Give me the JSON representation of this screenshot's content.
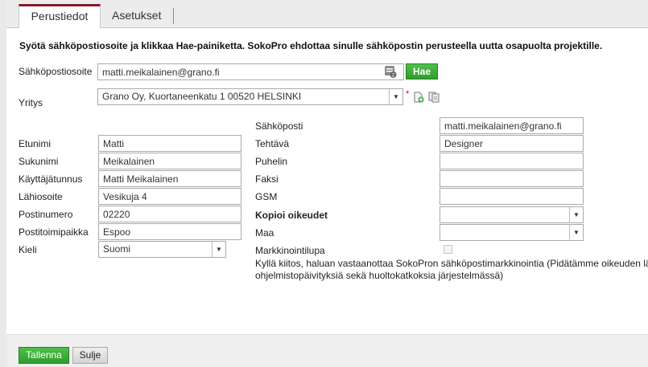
{
  "tabs": [
    {
      "label": "Perustiedot",
      "active": true
    },
    {
      "label": "Asetukset",
      "active": false
    }
  ],
  "intro": "Syötä sähköpostiosoite ja klikkaa Hae-painiketta. SokoPro ehdottaa sinulle sähköpostin perusteella uutta osapuolta projektille.",
  "lookup": {
    "label": "Sähköpostiosoite",
    "value": "matti.meikalainen@grano.fi",
    "search_button": "Hae"
  },
  "company": {
    "label": "Yritys",
    "value": "Grano Oy, Kuortaneenkatu 1 00520 HELSINKI",
    "required_mark": "*"
  },
  "left_fields": {
    "first_name": {
      "label": "Etunimi",
      "value": "Matti"
    },
    "last_name": {
      "label": "Sukunimi",
      "value": "Meikalainen"
    },
    "username": {
      "label": "Käyttäjätunnus",
      "value": "Matti Meikalainen"
    },
    "street": {
      "label": "Lähiosoite",
      "value": "Vesikuja 4"
    },
    "postcode": {
      "label": "Postinumero",
      "value": "02220"
    },
    "city": {
      "label": "Postitoimipaikka",
      "value": "Espoo"
    },
    "language": {
      "label": "Kieli",
      "value": "Suomi"
    }
  },
  "right_fields": {
    "email": {
      "label": "Sähköposti",
      "value": "matti.meikalainen@grano.fi"
    },
    "title": {
      "label": "Tehtävä",
      "value": "Designer"
    },
    "phone": {
      "label": "Puhelin",
      "value": ""
    },
    "fax": {
      "label": "Faksi",
      "value": ""
    },
    "gsm": {
      "label": "GSM",
      "value": ""
    },
    "copy_rights": {
      "label": "Kopioi oikeudet",
      "value": ""
    },
    "country": {
      "label": "Maa",
      "value": ""
    },
    "marketing": {
      "label": "Markkinointilupa",
      "checked": false
    }
  },
  "consent_line1": "Kyllä kiitos, haluan vastaanottaa SokoPron sähköpostimarkkinointia (Pidätämme oikeuden lä",
  "consent_line2": "ohjelmistopäivityksiä sekä huoltokatkoksia järjestelmässä)",
  "footer": {
    "save": "Tallenna",
    "close": "Sulje"
  },
  "icons": [
    "contact-card-icon",
    "add-company-icon",
    "copy-company-icon",
    "dropdown-arrow-icon"
  ],
  "colors": {
    "accent_tab": "#8b1a2b",
    "button_green": "#3aa836"
  }
}
